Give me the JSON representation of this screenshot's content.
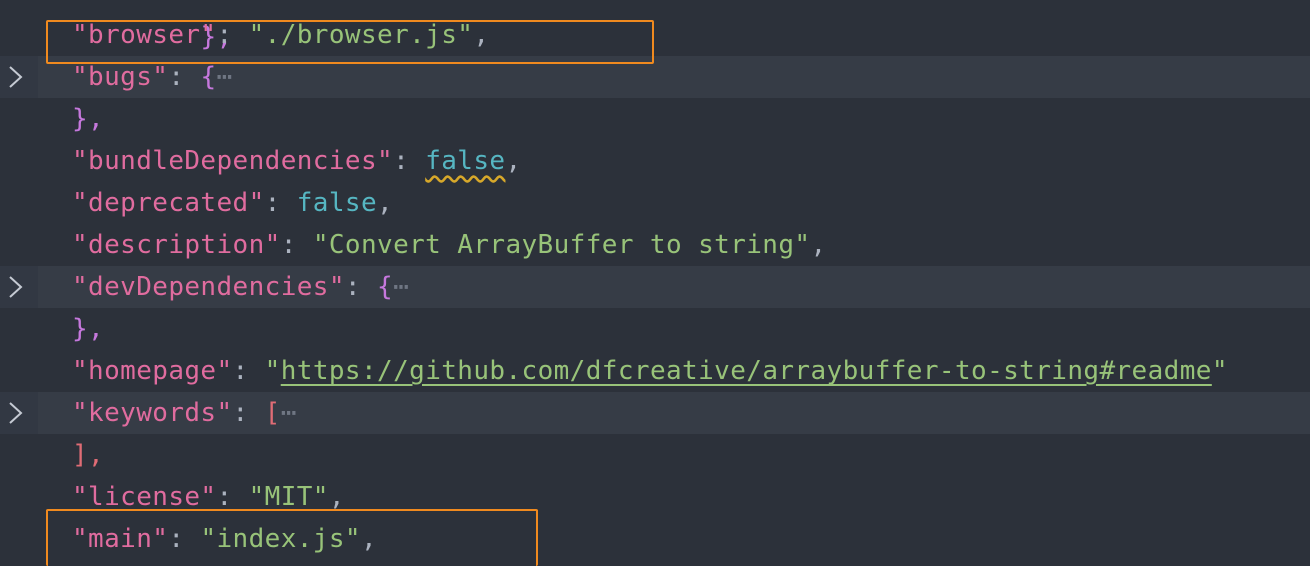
{
  "editor": {
    "lines": [
      {
        "id": "top",
        "text": "},"
      },
      {
        "id": "browser",
        "key": "\"browser\"",
        "sep": ": ",
        "value": "\"./browser.js\"",
        "tail": ","
      },
      {
        "id": "bugs",
        "key": "\"bugs\"",
        "sep": ": ",
        "open": "{",
        "ellipsis": "⋯"
      },
      {
        "id": "bugs-close",
        "text": "},"
      },
      {
        "id": "bundle",
        "key": "\"bundleDependencies\"",
        "sep": ": ",
        "value": "false",
        "tail": ","
      },
      {
        "id": "deprecated",
        "key": "\"deprecated\"",
        "sep": ": ",
        "value": "false",
        "tail": ","
      },
      {
        "id": "description",
        "key": "\"description\"",
        "sep": ": ",
        "value": "\"Convert ArrayBuffer to string\"",
        "tail": ","
      },
      {
        "id": "devdeps",
        "key": "\"devDependencies\"",
        "sep": ": ",
        "open": "{",
        "ellipsis": "⋯"
      },
      {
        "id": "devdeps-close",
        "text": "},"
      },
      {
        "id": "homepage",
        "key": "\"homepage\"",
        "sep": ": ",
        "quote": "\"",
        "url": "https://github.com/dfcreative/arraybuffer-to-string#readme",
        "quote_end": "\""
      },
      {
        "id": "keywords",
        "key": "\"keywords\"",
        "sep": ": ",
        "open": "[",
        "ellipsis": "⋯"
      },
      {
        "id": "keywords-close",
        "text": "],"
      },
      {
        "id": "license",
        "key": "\"license\"",
        "sep": ": ",
        "value": "\"MIT\"",
        "tail": ","
      },
      {
        "id": "main",
        "key": "\"main\"",
        "sep": ": ",
        "value": "\"index.js\"",
        "tail": ","
      }
    ]
  },
  "colors": {
    "background": "#2c313a",
    "folded_line": "#363c46",
    "key": "#e06c9f",
    "string": "#98c379",
    "boolean": "#56b6c2",
    "brace": "#c678dd",
    "highlight_box": "#f08a1f",
    "warning_squiggle": "#d7a82a"
  },
  "icons": {
    "fold": "chevron-right-icon"
  }
}
